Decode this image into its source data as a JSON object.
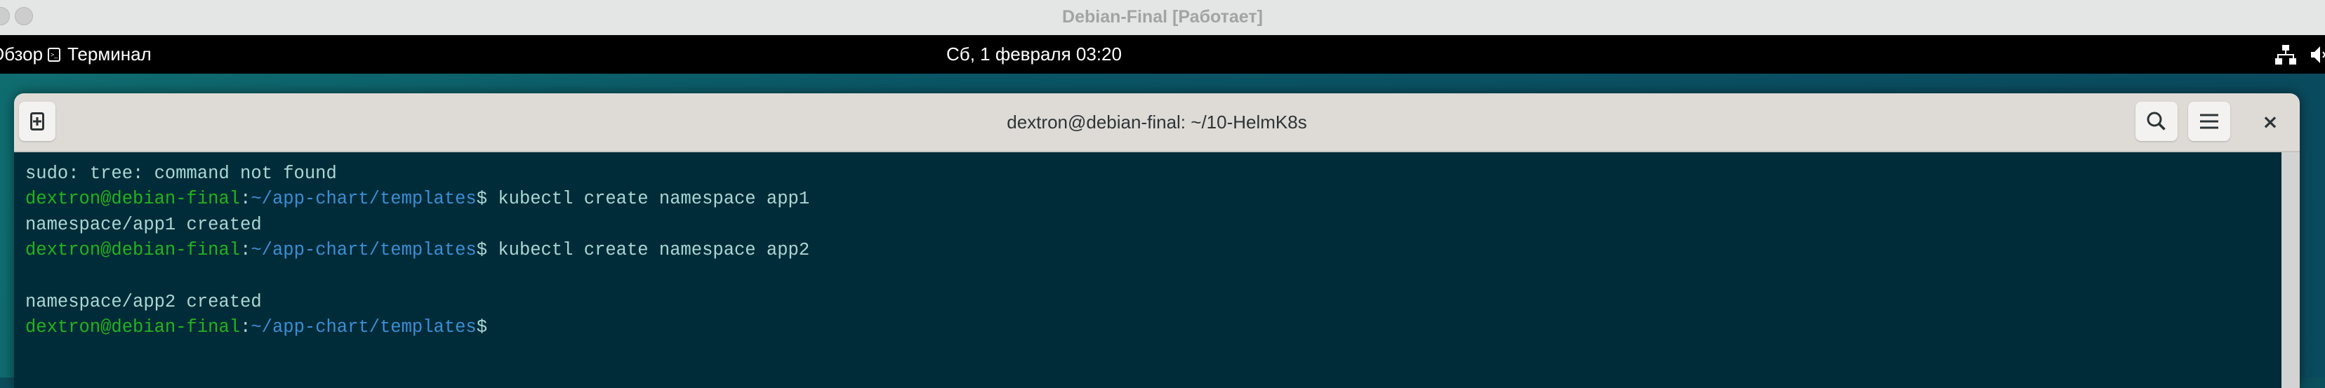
{
  "vm_window": {
    "title": "Debian-Final [Работает]"
  },
  "topbar": {
    "activities": "Обзор",
    "app_menu": "Терминал",
    "clock": "Сб, 1 февраля  03:20",
    "icons": [
      "network-icon",
      "volume-muted-icon"
    ]
  },
  "terminal": {
    "title": "dextron@debian-final: ~/10-HelmK8s",
    "icons": [
      "new-tab-icon",
      "search-icon",
      "hamburger-menu-icon",
      "close-icon"
    ],
    "colors": {
      "background": "#002b38",
      "user": "#22b41c",
      "path": "#3a8fd6",
      "text": "#a8d8d4"
    },
    "lines": [
      {
        "text": "sudo: tree: command not found"
      },
      {
        "user": "dextron@debian-final",
        "sep": ":",
        "path": "~/app-chart/templates",
        "prompt": "$",
        "cmd": " kubectl create namespace app1"
      },
      {
        "text": "namespace/app1 created"
      },
      {
        "user": "dextron@debian-final",
        "sep": ":",
        "path": "~/app-chart/templates",
        "prompt": "$",
        "cmd": " kubectl create namespace app2"
      },
      {
        "text": ""
      },
      {
        "text": "namespace/app2 created"
      },
      {
        "user": "dextron@debian-final",
        "sep": ":",
        "path": "~/app-chart/templates",
        "prompt": "$",
        "cmd": ""
      }
    ]
  }
}
